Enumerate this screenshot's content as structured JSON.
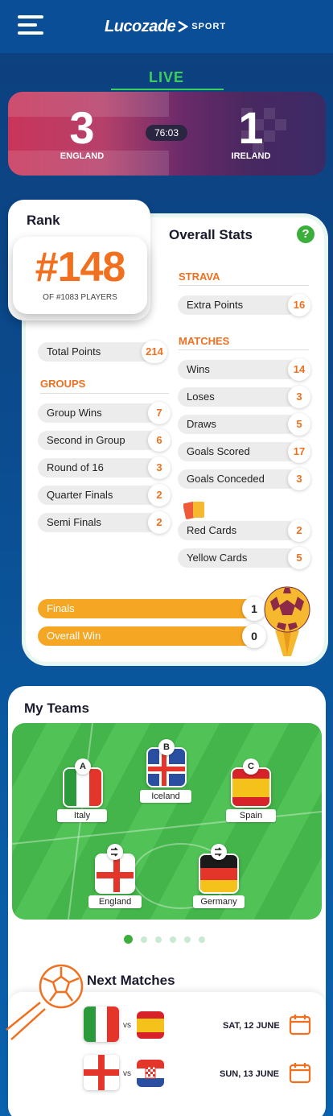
{
  "header": {
    "logo_main": "Lucozade",
    "logo_sub": "SPORT"
  },
  "live": {
    "label": "LIVE",
    "home_score": "3",
    "away_score": "1",
    "home_team": "ENGLAND",
    "away_team": "IRELAND",
    "clock": "76:03"
  },
  "rank": {
    "title": "Rank",
    "position": "#148",
    "of_label": "OF #1083 PLAYERS"
  },
  "stats": {
    "title": "Overall Stats",
    "help": "?",
    "total_points": {
      "label": "Total Points",
      "value": "214"
    },
    "groups_label": "GROUPS",
    "groups": [
      {
        "label": "Group Wins",
        "value": "7"
      },
      {
        "label": "Second in Group",
        "value": "6"
      },
      {
        "label": "Round of 16",
        "value": "3"
      },
      {
        "label": "Quarter Finals",
        "value": "2"
      },
      {
        "label": "Semi Finals",
        "value": "2"
      }
    ],
    "strava_label": "STRAVA",
    "strava": [
      {
        "label": "Extra Points",
        "value": "16"
      }
    ],
    "matches_label": "MATCHES",
    "matches": [
      {
        "label": "Wins",
        "value": "14"
      },
      {
        "label": "Loses",
        "value": "3"
      },
      {
        "label": "Draws",
        "value": "5"
      },
      {
        "label": "Goals Scored",
        "value": "17"
      },
      {
        "label": "Goals Conceded",
        "value": "3"
      }
    ],
    "cards": [
      {
        "label": "Red Cards",
        "value": "2"
      },
      {
        "label": "Yellow Cards",
        "value": "5"
      }
    ],
    "finals": [
      {
        "label": "Finals",
        "value": "1"
      },
      {
        "label": "Overall Win",
        "value": "0"
      }
    ]
  },
  "my_teams": {
    "title": "My Teams",
    "teams": [
      {
        "name": "Italy",
        "letter": "A"
      },
      {
        "name": "Iceland",
        "letter": "B"
      },
      {
        "name": "Spain",
        "letter": "C"
      },
      {
        "name": "England",
        "letter": ""
      },
      {
        "name": "Germany",
        "letter": ""
      }
    ],
    "pages": 6,
    "active_page": 1
  },
  "next_matches": {
    "title": "Next Matches",
    "matches": [
      {
        "home": "Italy",
        "away": "Spain",
        "vs": "vs",
        "date": "SAT, 12 JUNE"
      },
      {
        "home": "England",
        "away": "Croatia",
        "vs": "vs",
        "date": "SUN, 13 JUNE"
      }
    ]
  },
  "colors": {
    "accent": "#f07020",
    "live_green": "#3ccf5a",
    "finals_yellow": "#f5a623",
    "header_blue": "#0a4e98"
  }
}
